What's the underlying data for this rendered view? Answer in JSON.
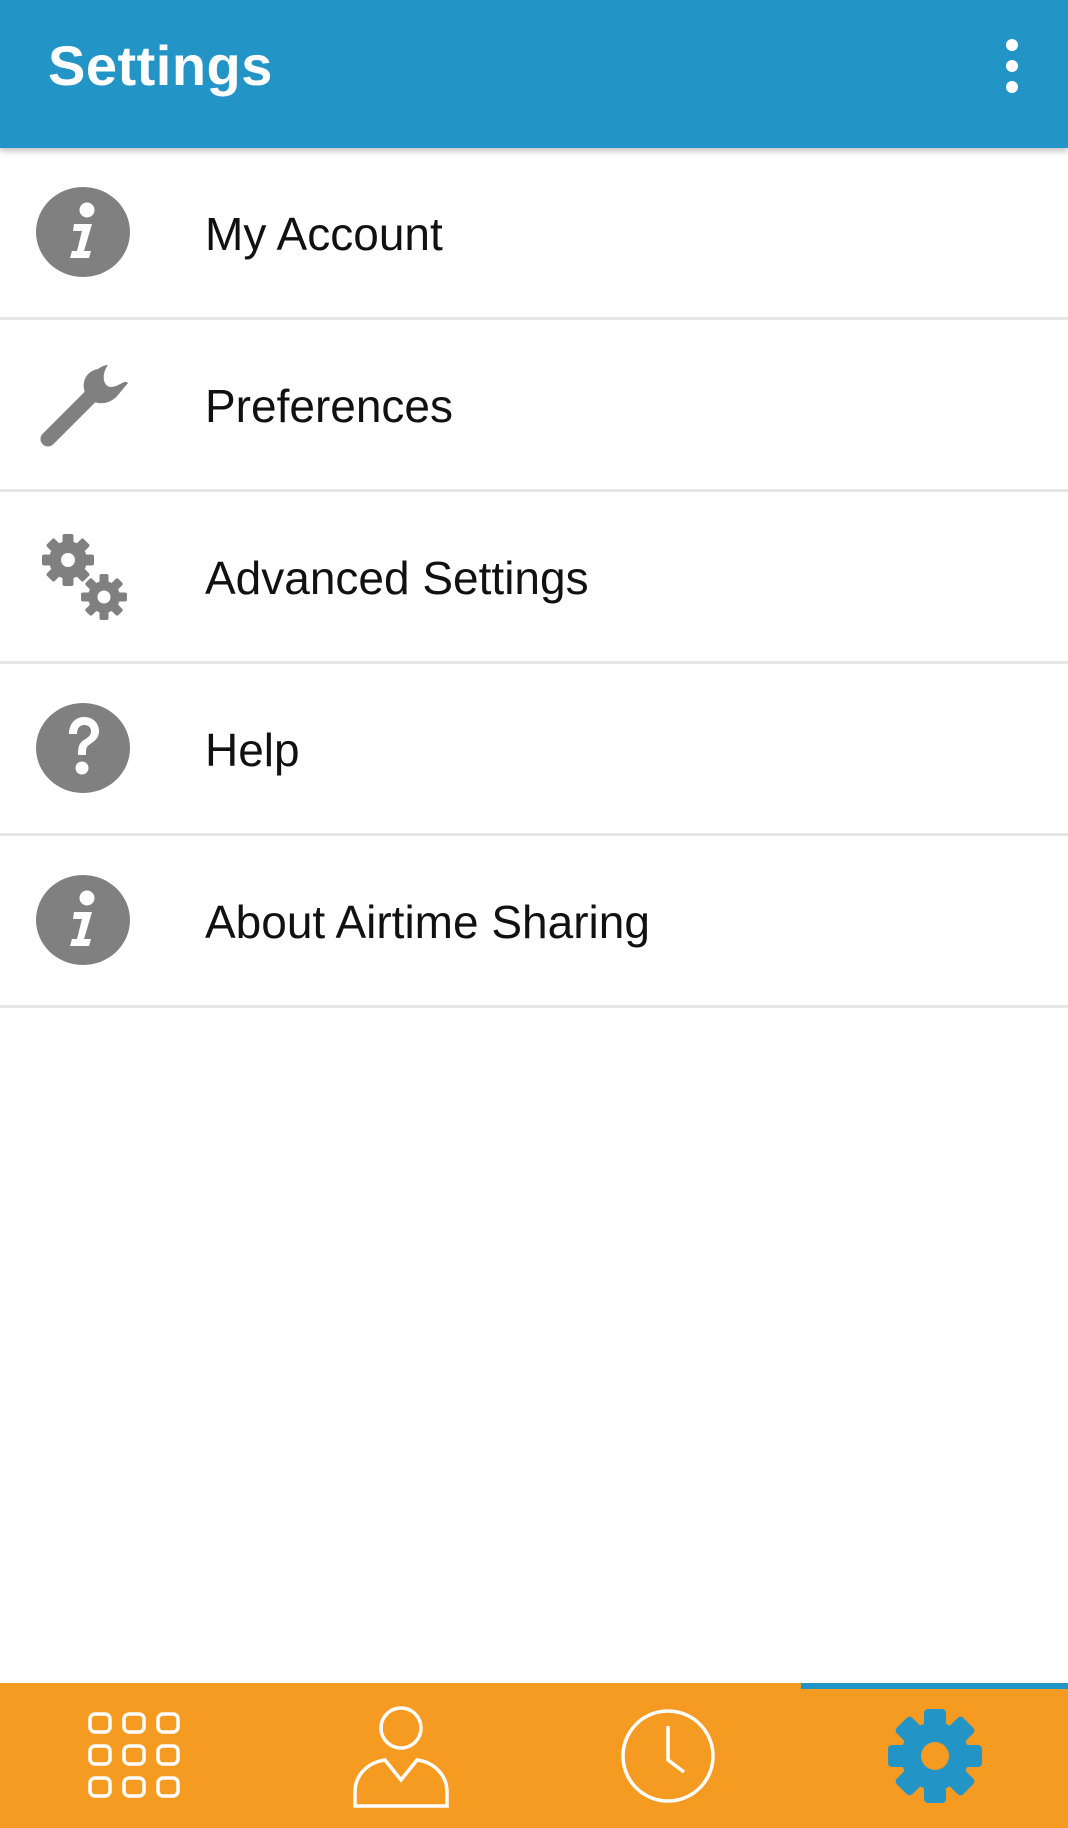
{
  "app_bar": {
    "title": "Settings",
    "overflow_icon": "more-vert-icon"
  },
  "menu": [
    {
      "label": "My Account",
      "icon": "info-icon"
    },
    {
      "label": "Preferences",
      "icon": "wrench-icon"
    },
    {
      "label": "Advanced Settings",
      "icon": "gears-icon"
    },
    {
      "label": "Help",
      "icon": "help-icon"
    },
    {
      "label": "About Airtime Sharing",
      "icon": "info-icon"
    }
  ],
  "bottom_nav": {
    "tabs": [
      {
        "icon": "dialpad-icon",
        "active": false
      },
      {
        "icon": "contact-icon",
        "active": false
      },
      {
        "icon": "clock-icon",
        "active": false
      },
      {
        "icon": "settings-gear-icon",
        "active": true
      }
    ]
  },
  "colors": {
    "app_bar": "#2394c6",
    "bottom_nav": "#f69b22",
    "icon_gray": "#808080",
    "active_accent": "#2394c6",
    "divider": "#e6e6e6"
  }
}
